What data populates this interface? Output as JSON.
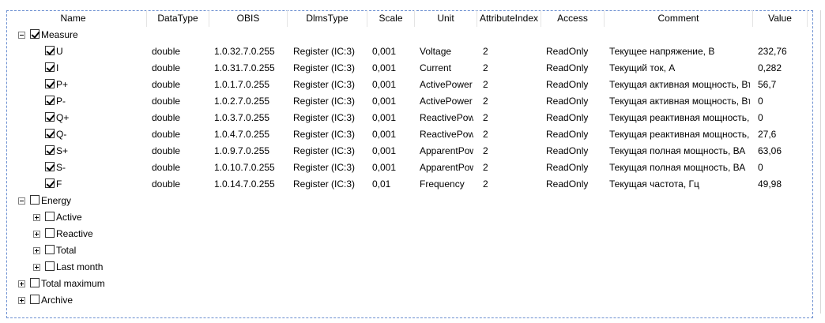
{
  "columns": [
    "Name",
    "DataType",
    "OBIS",
    "DlmsType",
    "Scale",
    "Unit",
    "AttributeIndex",
    "Access",
    "Comment",
    "Value"
  ],
  "tree": [
    {
      "name": "Measure",
      "expanded": true,
      "checked": true,
      "children": [
        {
          "name": "U",
          "checked": true,
          "dataType": "double",
          "obis": "1.0.32.7.0.255",
          "dlmsType": "Register (IC:3)",
          "scale": "0,001",
          "unit": "Voltage",
          "attributeIndex": "2",
          "access": "ReadOnly",
          "comment": "Текущее напряжение, В",
          "value": "232,76"
        },
        {
          "name": "I",
          "checked": true,
          "dataType": "double",
          "obis": "1.0.31.7.0.255",
          "dlmsType": "Register (IC:3)",
          "scale": "0,001",
          "unit": "Current",
          "attributeIndex": "2",
          "access": "ReadOnly",
          "comment": "Текущий ток, А",
          "value": "0,282"
        },
        {
          "name": "P+",
          "checked": true,
          "dataType": "double",
          "obis": "1.0.1.7.0.255",
          "dlmsType": "Register (IC:3)",
          "scale": "0,001",
          "unit": "ActivePower",
          "attributeIndex": "2",
          "access": "ReadOnly",
          "comment": "Текущая активная мощность, Вт",
          "value": "56,7"
        },
        {
          "name": "P-",
          "checked": true,
          "dataType": "double",
          "obis": "1.0.2.7.0.255",
          "dlmsType": "Register (IC:3)",
          "scale": "0,001",
          "unit": "ActivePower",
          "attributeIndex": "2",
          "access": "ReadOnly",
          "comment": "Текущая активная мощность, Вт",
          "value": "0"
        },
        {
          "name": "Q+",
          "checked": true,
          "dataType": "double",
          "obis": "1.0.3.7.0.255",
          "dlmsType": "Register (IC:3)",
          "scale": "0,001",
          "unit": "ReactivePower",
          "attributeIndex": "2",
          "access": "ReadOnly",
          "comment": "Текущая реактивная мощность, ВАр",
          "value": "0"
        },
        {
          "name": "Q-",
          "checked": true,
          "dataType": "double",
          "obis": "1.0.4.7.0.255",
          "dlmsType": "Register (IC:3)",
          "scale": "0,001",
          "unit": "ReactivePower",
          "attributeIndex": "2",
          "access": "ReadOnly",
          "comment": "Текущая реактивная мощность, ВАр",
          "value": "27,6"
        },
        {
          "name": "S+",
          "checked": true,
          "dataType": "double",
          "obis": "1.0.9.7.0.255",
          "dlmsType": "Register (IC:3)",
          "scale": "0,001",
          "unit": "ApparentPower",
          "attributeIndex": "2",
          "access": "ReadOnly",
          "comment": "Текущая полная мощность, ВА",
          "value": "63,06"
        },
        {
          "name": "S-",
          "checked": true,
          "dataType": "double",
          "obis": "1.0.10.7.0.255",
          "dlmsType": "Register (IC:3)",
          "scale": "0,001",
          "unit": "ApparentPower",
          "attributeIndex": "2",
          "access": "ReadOnly",
          "comment": "Текущая полная мощность, ВА",
          "value": "0"
        },
        {
          "name": "F",
          "checked": true,
          "dataType": "double",
          "obis": "1.0.14.7.0.255",
          "dlmsType": "Register (IC:3)",
          "scale": "0,01",
          "unit": "Frequency",
          "attributeIndex": "2",
          "access": "ReadOnly",
          "comment": "Текущая частота, Гц",
          "value": "49,98"
        }
      ]
    },
    {
      "name": "Energy",
      "expanded": true,
      "checked": false,
      "children": [
        {
          "name": "Active",
          "checked": false,
          "collapsed": true
        },
        {
          "name": "Reactive",
          "checked": false,
          "collapsed": true
        },
        {
          "name": "Total",
          "checked": false,
          "collapsed": true
        },
        {
          "name": "Last month",
          "checked": false,
          "collapsed": true
        }
      ]
    },
    {
      "name": "Total maximum",
      "expanded": false,
      "checked": false,
      "children": []
    },
    {
      "name": "Archive",
      "expanded": false,
      "checked": false,
      "children": []
    }
  ]
}
